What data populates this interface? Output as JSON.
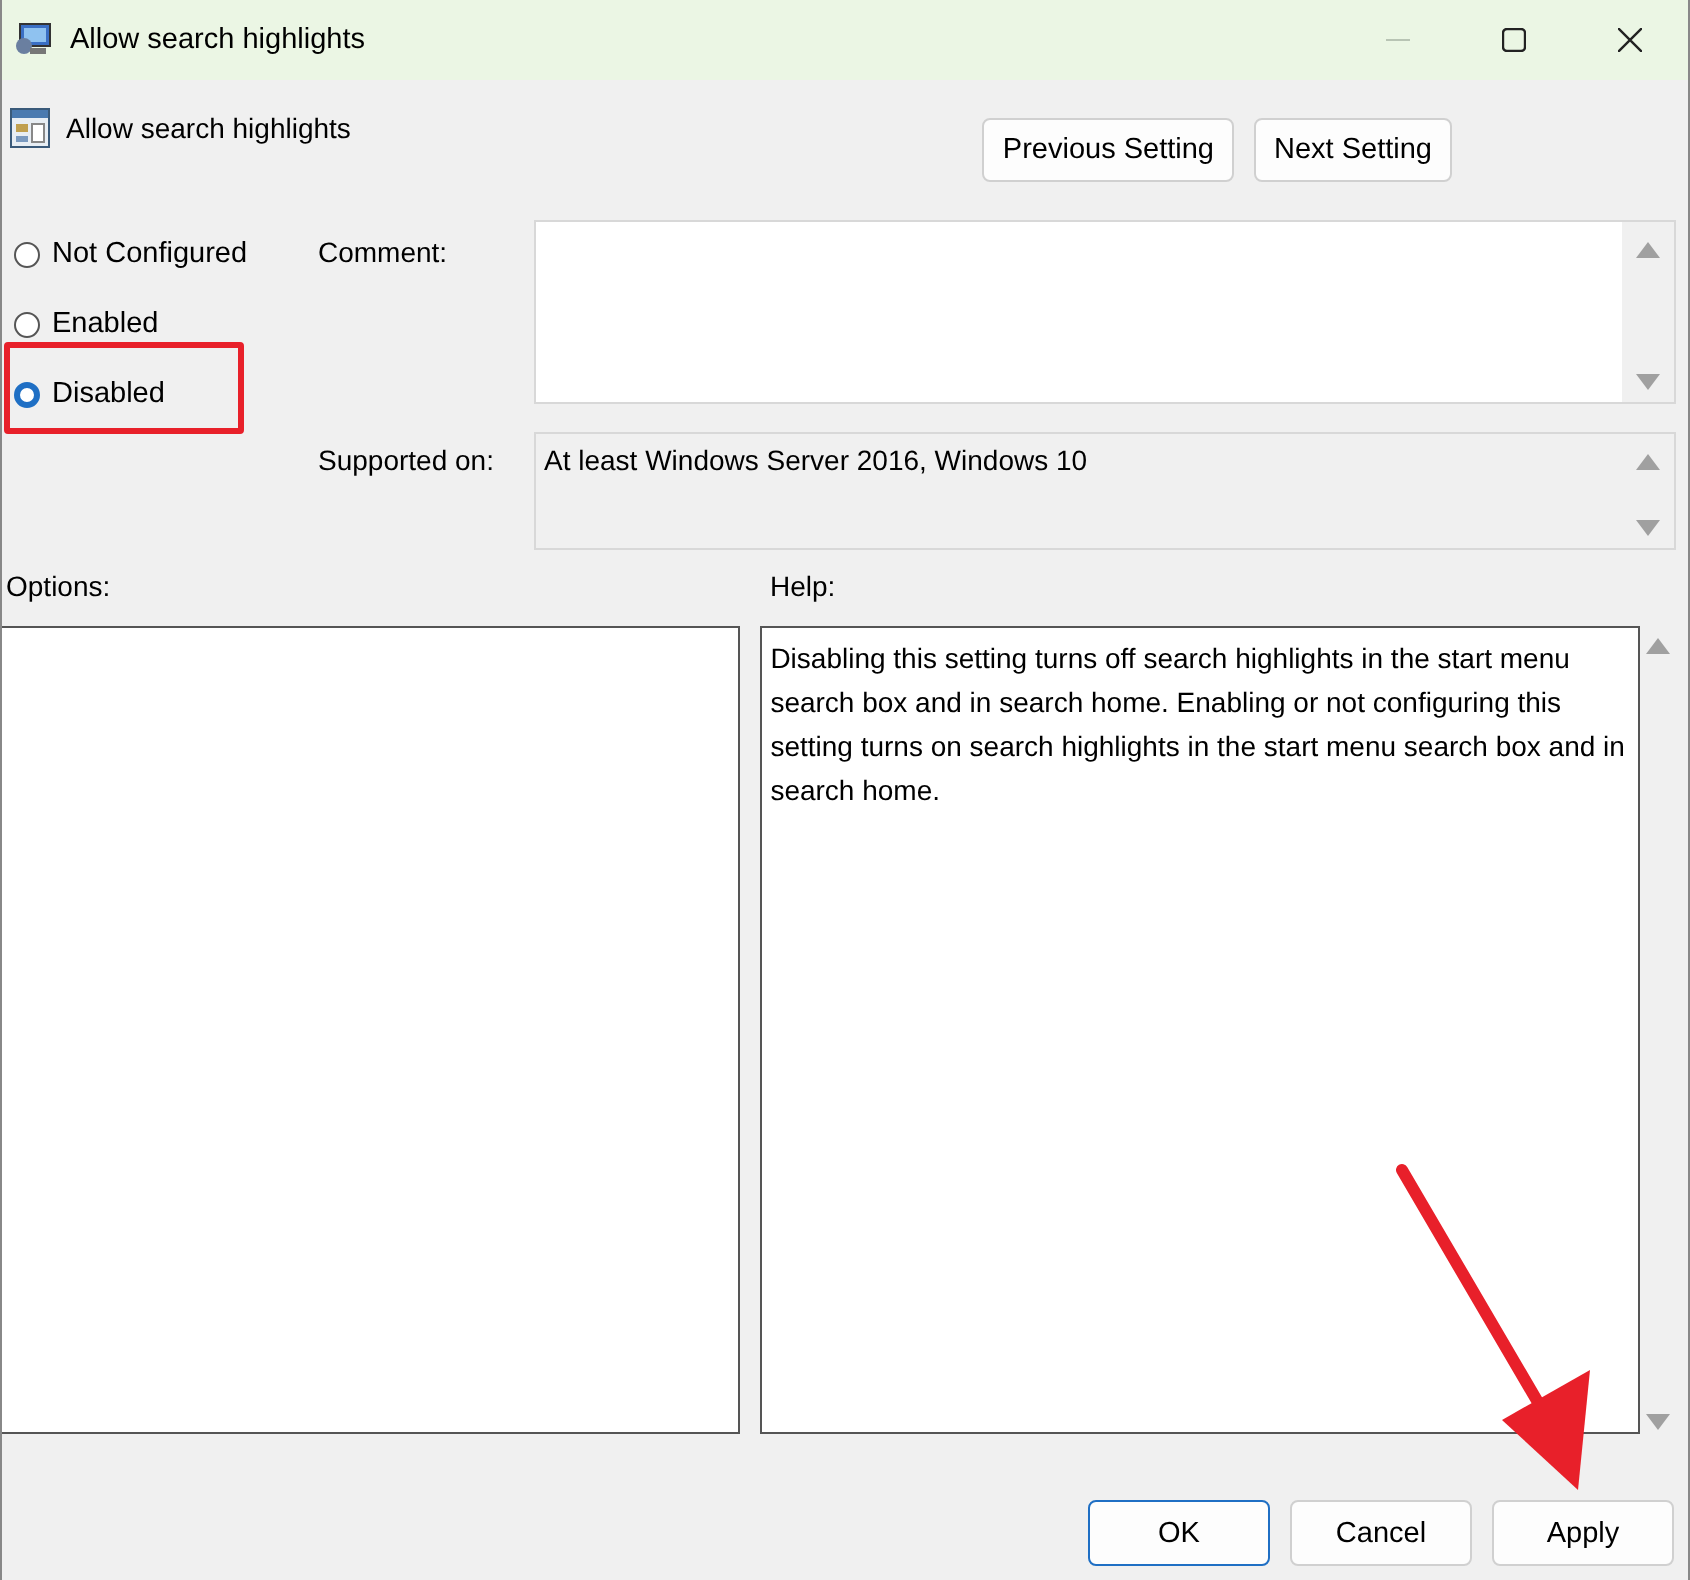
{
  "window": {
    "title": "Allow search highlights",
    "controls": [
      {
        "kind": "minimize",
        "disabled": true
      },
      {
        "kind": "maximize",
        "disabled": false
      },
      {
        "kind": "close",
        "disabled": false
      }
    ]
  },
  "policy": {
    "name": "Allow search highlights"
  },
  "nav_buttons": [
    "Previous Setting",
    "Next Setting"
  ],
  "state_options": [
    {
      "label": "Not Configured",
      "selected": false
    },
    {
      "label": "Enabled",
      "selected": false
    },
    {
      "label": "Disabled",
      "selected": true
    }
  ],
  "comment": {
    "label": "Comment:"
  },
  "supported_on": {
    "label": "Supported on:",
    "value": "At least Windows Server 2016, Windows 10"
  },
  "options": {
    "label": "Options:"
  },
  "help": {
    "label": "Help:",
    "text": "Disabling this setting turns off search highlights in the start menu search box and in search home. Enabling or not configuring this setting turns on search highlights in the start menu search box and in search home."
  },
  "buttons": [
    {
      "label": "OK",
      "default": true
    },
    {
      "label": "Cancel",
      "default": false
    },
    {
      "label": "Apply",
      "default": false
    }
  ]
}
